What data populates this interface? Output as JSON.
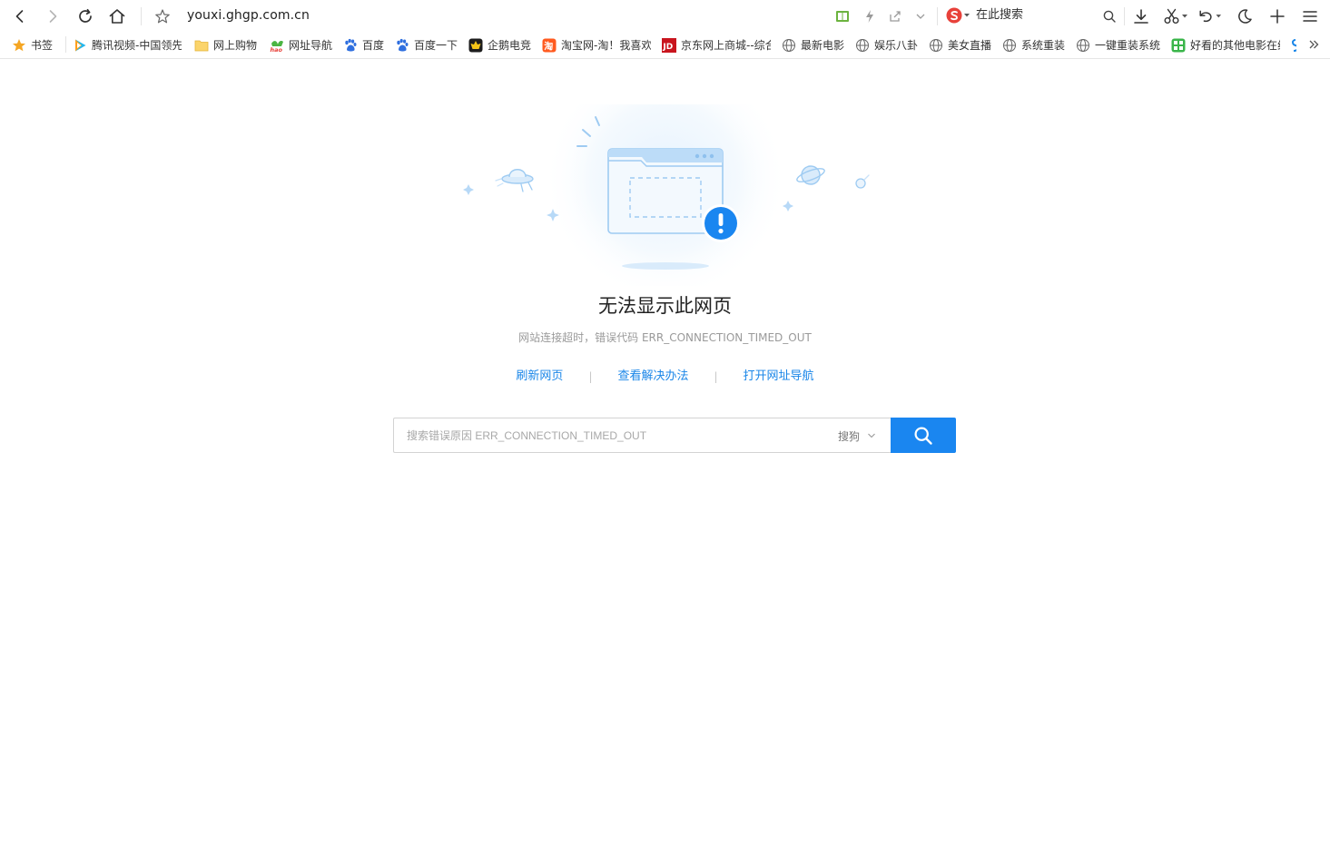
{
  "toolbar": {
    "url": "youxi.ghgp.com.cn",
    "search_placeholder": "在此搜索"
  },
  "bookmarks": [
    {
      "label": "书签",
      "icon": "star-icon"
    },
    {
      "label": "腾讯视频-中国领先",
      "icon": "tencent-video-icon"
    },
    {
      "label": "网上购物",
      "icon": "folder-icon"
    },
    {
      "label": "网址导航",
      "icon": "hao-icon"
    },
    {
      "label": "百度",
      "icon": "baidu-paw-icon"
    },
    {
      "label": "百度一下",
      "icon": "baidu-paw-icon"
    },
    {
      "label": "企鹅电竞",
      "icon": "penguin-esports-icon"
    },
    {
      "label": "淘宝网-淘！我喜欢",
      "icon": "taobao-icon"
    },
    {
      "label": "京东网上商城--综合",
      "icon": "jd-icon"
    },
    {
      "label": "最新电影",
      "icon": "globe-icon"
    },
    {
      "label": "娱乐八卦",
      "icon": "globe-icon"
    },
    {
      "label": "美女直播",
      "icon": "globe-icon"
    },
    {
      "label": "系统重装",
      "icon": "globe-icon"
    },
    {
      "label": "一键重装系统",
      "icon": "globe-icon"
    },
    {
      "label": "好看的其他电影在线",
      "icon": "green-grid-icon"
    }
  ],
  "error": {
    "title": "无法显示此网页",
    "description": "网站连接超时，错误代码 ERR_CONNECTION_TIMED_OUT",
    "links": {
      "refresh": "刷新网页",
      "solution": "查看解决办法",
      "navigation": "打开网址导航"
    },
    "search_placeholder": "搜索错误原因 ERR_CONNECTION_TIMED_OUT",
    "engine": "搜狗"
  },
  "colors": {
    "accent": "#1a86f0",
    "link": "#1a86e8",
    "illustration": "#b9dbf8"
  }
}
